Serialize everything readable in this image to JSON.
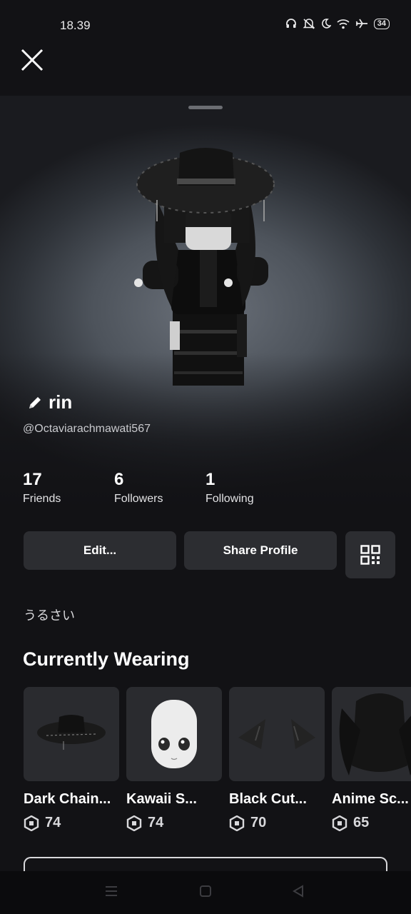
{
  "status_bar": {
    "time": "18.39",
    "battery": "34"
  },
  "profile": {
    "display_name": "rin",
    "username": "@Octaviarachmawati567",
    "stats": [
      {
        "value": "17",
        "label": "Friends"
      },
      {
        "value": "6",
        "label": "Followers"
      },
      {
        "value": "1",
        "label": "Following"
      }
    ],
    "bio": "うるさい"
  },
  "actions": {
    "edit_label": "Edit...",
    "share_label": "Share Profile"
  },
  "wearing": {
    "title": "Currently Wearing",
    "items": [
      {
        "name": "Dark Chain...",
        "price": "74"
      },
      {
        "name": "Kawaii S...",
        "price": "74"
      },
      {
        "name": "Black Cut...",
        "price": "70"
      },
      {
        "name": "Anime Sc...",
        "price": "65"
      }
    ]
  }
}
